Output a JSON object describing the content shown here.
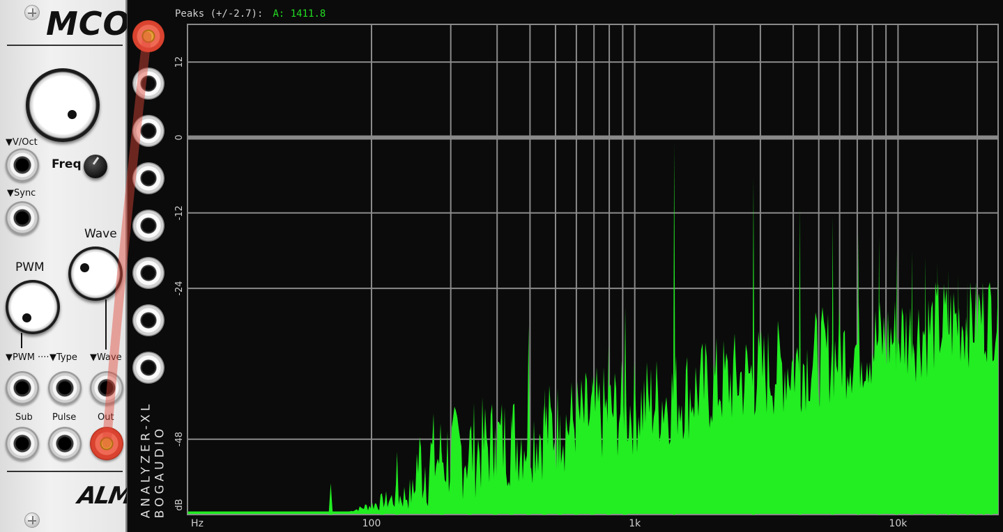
{
  "mco": {
    "title": "MCO",
    "labels": {
      "voct": "▼V/Oct",
      "freq": "Freq",
      "sync": "▼Sync",
      "wave": "Wave",
      "pwm": "PWM",
      "pwm_in": "▼PWM ····",
      "type_in": "▼Type",
      "wave_in": "▼Wave",
      "sub": "Sub",
      "pulse": "Pulse",
      "out": "Out"
    },
    "logo": "ALM"
  },
  "analyzer": {
    "brand_line1": "ANALYZER-XL",
    "brand_line2": "BOGAUDIO",
    "peaks_label": "Peaks (+/-2.7):",
    "peaks_value": "A: 1411.8",
    "y_ticks": [
      "12",
      "0",
      "-12",
      "-24",
      "-48"
    ],
    "y_unit": "dB",
    "x_unit": "Hz",
    "x_ticks": [
      "100",
      "1k",
      "10k"
    ],
    "colors": {
      "spectrum": "#22ee22",
      "grid": "#8a8a8a",
      "background": "#0b0b0b",
      "cable": "#e2473a"
    }
  },
  "chart_data": {
    "type": "area",
    "xscale": "log",
    "xlim": [
      20,
      24000
    ],
    "ylim": [
      -60,
      18
    ],
    "xlabel": "Hz",
    "ylabel": "dB",
    "x_ticks": [
      "100",
      "1k",
      "10k"
    ],
    "y_ticks": [
      "12",
      "0",
      "-12",
      "-24",
      "-48"
    ],
    "peak_readout": "A: 1411.8",
    "harmonic_peaks": {
      "x": [
        1411.8,
        2823.6,
        4235.4,
        5647.2,
        7059,
        8470.8,
        9882.6,
        11294.4,
        12706.2,
        14118,
        15529.8,
        16941.6,
        18353.4,
        19765.2,
        21177,
        22588.8
      ],
      "y": [
        -1,
        -6.5,
        -11,
        -12.5,
        -15,
        -16,
        -18,
        -18,
        -19,
        -20,
        -21,
        -22,
        -23,
        -23,
        -24,
        -25
      ]
    },
    "subharmonic_peaks": {
      "x": [
        70,
        110,
        125,
        185,
        236,
        295,
        340,
        395,
        455,
        520,
        600,
        690,
        795,
        920
      ],
      "y": [
        -55,
        -57,
        -50,
        -50,
        -49,
        -46,
        -44,
        -30,
        -40,
        -44,
        -41,
        -38,
        -33,
        -27
      ]
    }
  }
}
